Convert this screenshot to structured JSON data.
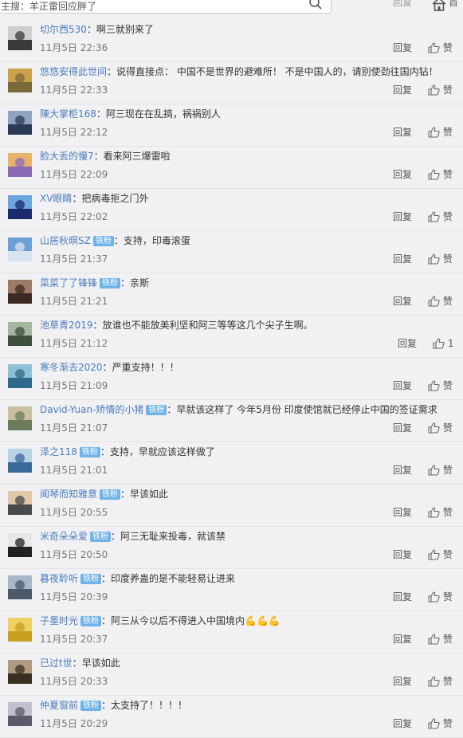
{
  "search": {
    "text": "主搜：羊正雷回应胖了"
  },
  "topbar": {
    "right_text": "回复",
    "tail_text": "首"
  },
  "reply_label": "回复",
  "like_label": "赞",
  "badge_label": "铁粉",
  "comments": [
    {
      "user": "切尔西530",
      "badge": false,
      "text": "啊三就别来了",
      "time": "11月5日 22:36",
      "like": "赞",
      "avatar_colors": [
        "#3a3a3a",
        "#cfcfcf"
      ]
    },
    {
      "user": "悠悠安得此世间",
      "badge": false,
      "text": "说得直接点： 中国不是世界的避难所！ 不是中国人的，请别使劲往国内钻！",
      "time": "11月5日 22:33",
      "like": "赞",
      "avatar_colors": [
        "#7a6a3a",
        "#c9a24a"
      ]
    },
    {
      "user": "陳大掌柜168",
      "badge": false,
      "text": "阿三现在在乱搞，祸祸别人",
      "time": "11月5日 22:12",
      "like": "赞",
      "avatar_colors": [
        "#2a3a55",
        "#8fa3bf"
      ]
    },
    {
      "user": "脸大丢的慢7",
      "badge": false,
      "text": "看来阿三爆雷啦",
      "time": "11月5日 22:09",
      "like": "赞",
      "avatar_colors": [
        "#8a6ab5",
        "#e6b36b"
      ]
    },
    {
      "user": "XV眼睛",
      "badge": false,
      "text": "把病毒拒之门外",
      "time": "11月5日 22:02",
      "like": "赞",
      "avatar_colors": [
        "#1b2a6b",
        "#6da5e0"
      ]
    },
    {
      "user": "山居秋暝SZ",
      "badge": true,
      "text": "支持，印毒滚蛋",
      "time": "11月5日 21:37",
      "like": "赞",
      "avatar_colors": [
        "#d8e3f0",
        "#6aa0d6"
      ]
    },
    {
      "user": "菜菜了了锋锋",
      "badge": true,
      "text": "亲斯",
      "time": "11月5日 21:21",
      "like": "赞",
      "avatar_colors": [
        "#3b2a22",
        "#9b7a66"
      ]
    },
    {
      "user": "池草青2019",
      "badge": false,
      "text": "放谁也不能放美利坚和阿三等等这几个尖子生啊。",
      "time": "11月5日 21:12",
      "like": "1",
      "avatar_colors": [
        "#3f4f3c",
        "#a6b6a0"
      ]
    },
    {
      "user": "寒冬渐去2020",
      "badge": false,
      "text": "严重支持！！！",
      "time": "11月5日 21:09",
      "like": "赞",
      "avatar_colors": [
        "#2f6a8a",
        "#8ec0d8"
      ]
    },
    {
      "user": "David-Yuan-矫情的小猪",
      "badge": true,
      "text": "早就该这样了 今年5月份 印度使馆就已经停止中国的签证需求",
      "time": "11月5日 21:07",
      "like": "赞",
      "avatar_colors": [
        "#6b7a5a",
        "#c8c0a0"
      ]
    },
    {
      "user": "泽之118",
      "badge": true,
      "text": "支持，早就应该这样做了",
      "time": "11月5日 21:01",
      "like": "赞",
      "avatar_colors": [
        "#3a6a9a",
        "#b8d2e6"
      ]
    },
    {
      "user": "闻琴而知雅意",
      "badge": true,
      "text": "早该如此",
      "time": "11月5日 20:55",
      "like": "赞",
      "avatar_colors": [
        "#4a4a4a",
        "#e0c8a8"
      ]
    },
    {
      "user": "米奇朵朵爱",
      "badge": true,
      "text": "阿三无耻来投毒，就该禁",
      "time": "11月5日 20:50",
      "like": "赞",
      "avatar_colors": [
        "#222222",
        "#e8e8e8"
      ]
    },
    {
      "user": "暮夜聆听",
      "badge": true,
      "text": "印度养蛊的是不能轻易让进来",
      "time": "11月5日 20:39",
      "like": "赞",
      "avatar_colors": [
        "#4a5a6a",
        "#a8b8c8"
      ]
    },
    {
      "user": "子墨时光",
      "badge": true,
      "text": "阿三从今以后不得进入中国境内💪💪💪",
      "time": "11月5日 20:37",
      "like": "赞",
      "avatar_colors": [
        "#c8a020",
        "#f0d060"
      ]
    },
    {
      "user": "已过t世",
      "badge": false,
      "text": "早该如此",
      "time": "11月5日 20:33",
      "like": "赞",
      "avatar_colors": [
        "#3a3022",
        "#b09a80"
      ]
    },
    {
      "user": "仲夏窗前",
      "badge": true,
      "text": "太支持了！！！！",
      "time": "11月5日 20:29",
      "like": "赞",
      "avatar_colors": [
        "#5a5a6a",
        "#c0c0d0"
      ]
    }
  ]
}
